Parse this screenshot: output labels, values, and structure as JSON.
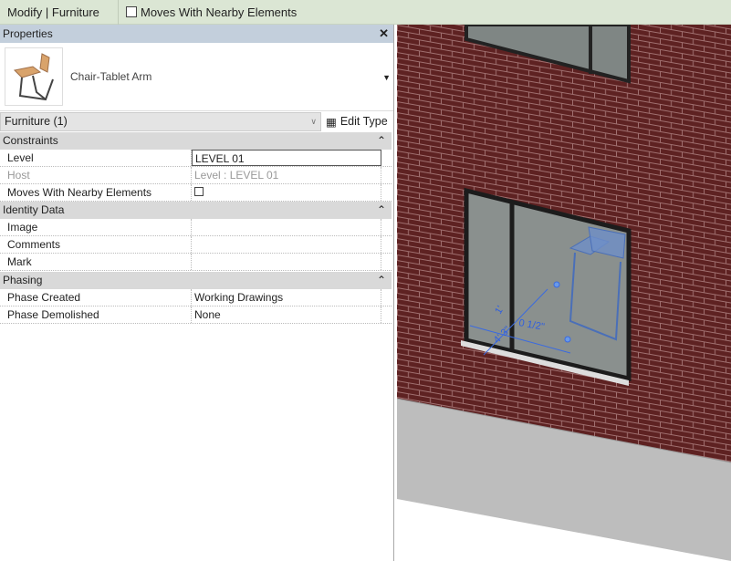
{
  "ribbon": {
    "context": "Modify | Furniture",
    "option_label": "Moves With Nearby Elements"
  },
  "properties": {
    "title": "Properties",
    "type_name": "Chair-Tablet Arm",
    "filter": "Furniture (1)",
    "edit_type": "Edit Type",
    "groups": [
      {
        "name": "Constraints",
        "rows": [
          {
            "k": "Level",
            "v": "LEVEL 01"
          },
          {
            "k": "Host",
            "v": "Level : LEVEL 01"
          },
          {
            "k": "Moves With Nearby Elements",
            "v": ""
          }
        ]
      },
      {
        "name": "Identity Data",
        "rows": [
          {
            "k": "Image",
            "v": ""
          },
          {
            "k": "Comments",
            "v": ""
          },
          {
            "k": "Mark",
            "v": ""
          }
        ]
      },
      {
        "name": "Phasing",
        "rows": [
          {
            "k": "Phase Created",
            "v": "Working Drawings"
          },
          {
            "k": "Phase Demolished",
            "v": "None"
          }
        ]
      }
    ]
  },
  "viewport": {
    "dims": [
      "1'",
      "4' 3\"",
      "0 1/2\""
    ],
    "brick_color": "#5e2222",
    "selection_color": "#2f5fe0"
  }
}
